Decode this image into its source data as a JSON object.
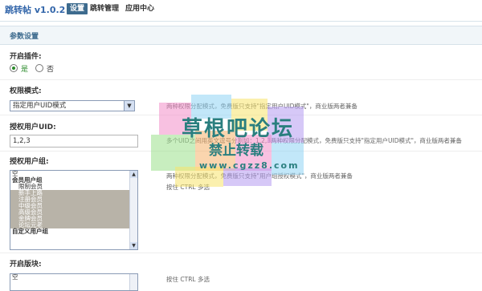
{
  "header": {
    "brand": "跳转帖 v1.0.2",
    "tabs": [
      {
        "label": "设置",
        "active": true
      },
      {
        "label": "跳转管理",
        "active": false
      },
      {
        "label": "应用中心",
        "active": false
      }
    ]
  },
  "section": {
    "title": "参数设置"
  },
  "fields": {
    "enable": {
      "label": "开启插件:",
      "options": [
        {
          "label": "是",
          "checked": true
        },
        {
          "label": "否",
          "checked": false
        }
      ]
    },
    "mode": {
      "label": "权限模式:",
      "selected": "指定用户UID模式",
      "help": "两种权限分配模式，免费版只支持\"指定用户UID模式\"，商业版两者兼备"
    },
    "uids": {
      "label": "授权用户UID:",
      "value": "1,2,3",
      "help": "多个UID之间用英文逗号分割如：1,2,3两种权限分配模式，免费版只支持\"指定用户UID模式\"，商业版两者兼备"
    },
    "groups": {
      "label": "授权用户组:",
      "options": [
        {
          "label": "空",
          "type": "option",
          "selected": false
        },
        {
          "label": "会员用户组",
          "type": "group",
          "selected": false
        },
        {
          "label": "限制会员",
          "type": "option",
          "selected": false
        },
        {
          "label": "新手上路",
          "type": "option",
          "selected": true
        },
        {
          "label": "注册会员",
          "type": "option",
          "selected": true
        },
        {
          "label": "中级会员",
          "type": "option",
          "selected": true
        },
        {
          "label": "高级会员",
          "type": "option",
          "selected": true
        },
        {
          "label": "金牌会员",
          "type": "option",
          "selected": true
        },
        {
          "label": "论坛元老",
          "type": "option",
          "selected": true
        },
        {
          "label": "自定义用户组",
          "type": "group",
          "selected": false
        }
      ],
      "help": "两种权限分配模式，免费版只支持\"用户组授权模式\"，商业版两者兼备",
      "hint": "按住 CTRL 多选"
    },
    "forums": {
      "label": "开启版块:",
      "options": [
        {
          "label": "空"
        }
      ],
      "hint": "按住 CTRL 多选"
    }
  },
  "watermark": {
    "line1": "草根吧论坛",
    "line2": "禁止转载",
    "line3": "www.cgzz8.com",
    "colors": [
      "#f28ec8",
      "#8fd3f4",
      "#f7e36b",
      "#b59bf0",
      "#9be08a",
      "#f6b26b"
    ]
  },
  "colors": {
    "accent": "#3d6b8e",
    "section_bg": "#f1f6f9",
    "list_selected": "#b8b3a8",
    "radio_checked": "#2a8a2a"
  }
}
